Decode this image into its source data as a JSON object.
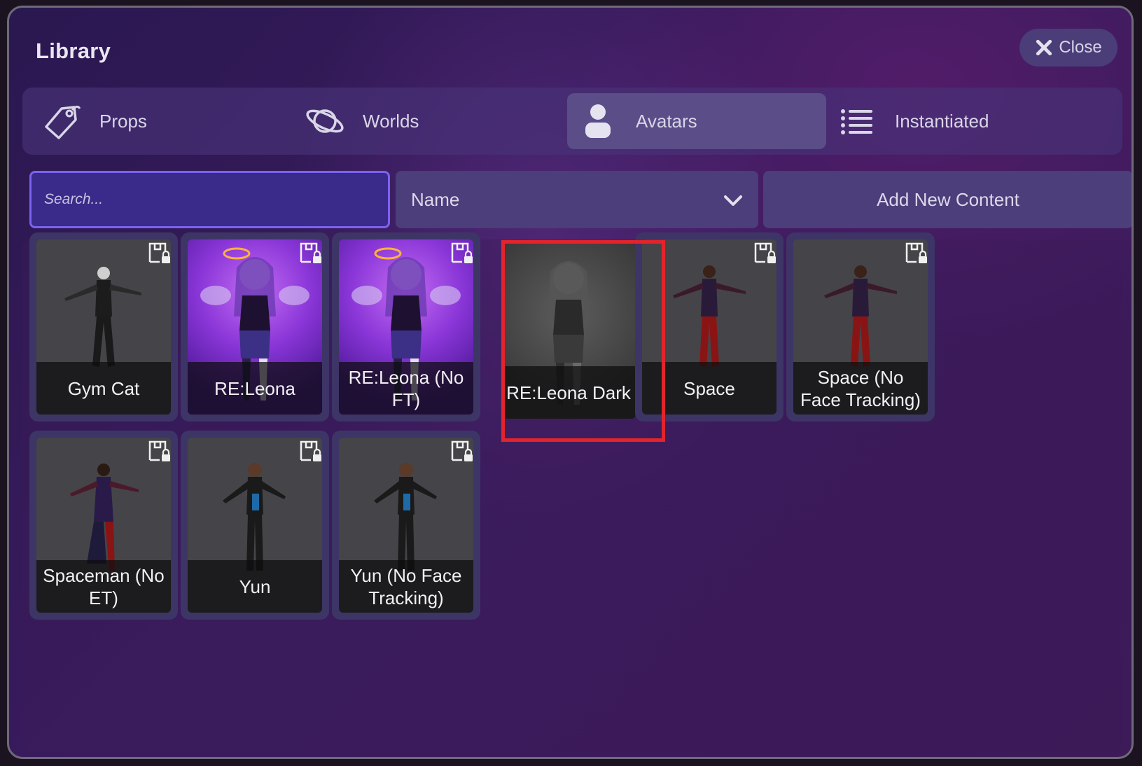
{
  "window": {
    "title": "Library",
    "close_label": "Close"
  },
  "tabs": [
    {
      "label": "Props",
      "icon": "tag-icon",
      "active": false
    },
    {
      "label": "Worlds",
      "icon": "planet-icon",
      "active": false
    },
    {
      "label": "Avatars",
      "icon": "user-icon",
      "active": true
    },
    {
      "label": "Instantiated",
      "icon": "list-icon",
      "active": false
    }
  ],
  "toolbar": {
    "search_placeholder": "Search...",
    "sort_value": "Name",
    "add_label": "Add New Content"
  },
  "avatars": [
    {
      "name": "Gym Cat",
      "thumb": "gray"
    },
    {
      "name": "RE:Leona",
      "thumb": "purple"
    },
    {
      "name": "RE:Leona (No FT)",
      "thumb": "purple"
    },
    {
      "name": "RE:Leona Dark",
      "thumb": "dark",
      "highlighted": true
    },
    {
      "name": "Space",
      "thumb": "gray"
    },
    {
      "name": "Space (No Face Tracking)",
      "thumb": "gray"
    },
    {
      "name": "Spaceman (No ET)",
      "thumb": "gray"
    },
    {
      "name": "Yun",
      "thumb": "gray"
    },
    {
      "name": "Yun (No Face Tracking)",
      "thumb": "gray"
    }
  ],
  "colors": {
    "highlight": "#e3242b",
    "accent": "#7a63f0"
  }
}
